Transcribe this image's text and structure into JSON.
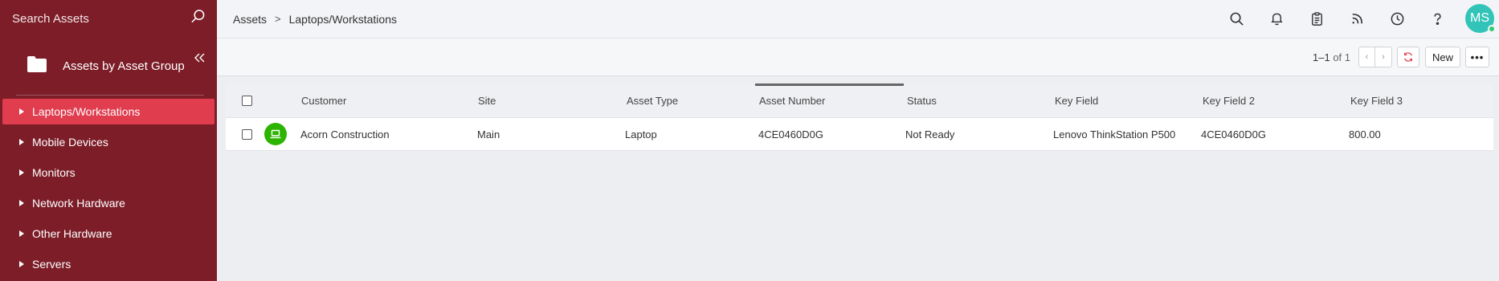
{
  "sidebar": {
    "search_placeholder": "Search Assets",
    "group_title": "Assets by Asset Group",
    "items": [
      {
        "label": "Laptops/Workstations",
        "active": true
      },
      {
        "label": "Mobile Devices",
        "active": false
      },
      {
        "label": "Monitors",
        "active": false
      },
      {
        "label": "Network Hardware",
        "active": false
      },
      {
        "label": "Other Hardware",
        "active": false
      },
      {
        "label": "Servers",
        "active": false
      }
    ]
  },
  "breadcrumb": {
    "root": "Assets",
    "separator": ">",
    "current": "Laptops/Workstations"
  },
  "topbar": {
    "icons": [
      "search-icon",
      "bell-icon",
      "clipboard-icon",
      "rss-icon",
      "clock-icon",
      "help-icon"
    ],
    "avatar_initials": "MS"
  },
  "toolbar": {
    "range": "1–1",
    "of_label": "of 1",
    "prev_label": "‹",
    "next_label": "›",
    "new_label": "New",
    "more_label": "•••"
  },
  "table": {
    "columns": [
      "Customer",
      "Site",
      "Asset Type",
      "Asset Number",
      "Status",
      "Key Field",
      "Key Field 2",
      "Key Field 3"
    ],
    "rows": [
      {
        "customer": "Acorn Construction",
        "site": "Main",
        "asset_type": "Laptop",
        "asset_number": "4CE0460D0G",
        "status": "Not Ready",
        "key_field": "Lenovo ThinkStation P500",
        "key_field_2": "4CE0460D0G",
        "key_field_3": "800.00"
      }
    ]
  },
  "colors": {
    "sidebar_bg": "#7c1d28",
    "active_item": "#e03d4f",
    "avatar": "#32c4b8",
    "asset_icon": "#2db400"
  }
}
